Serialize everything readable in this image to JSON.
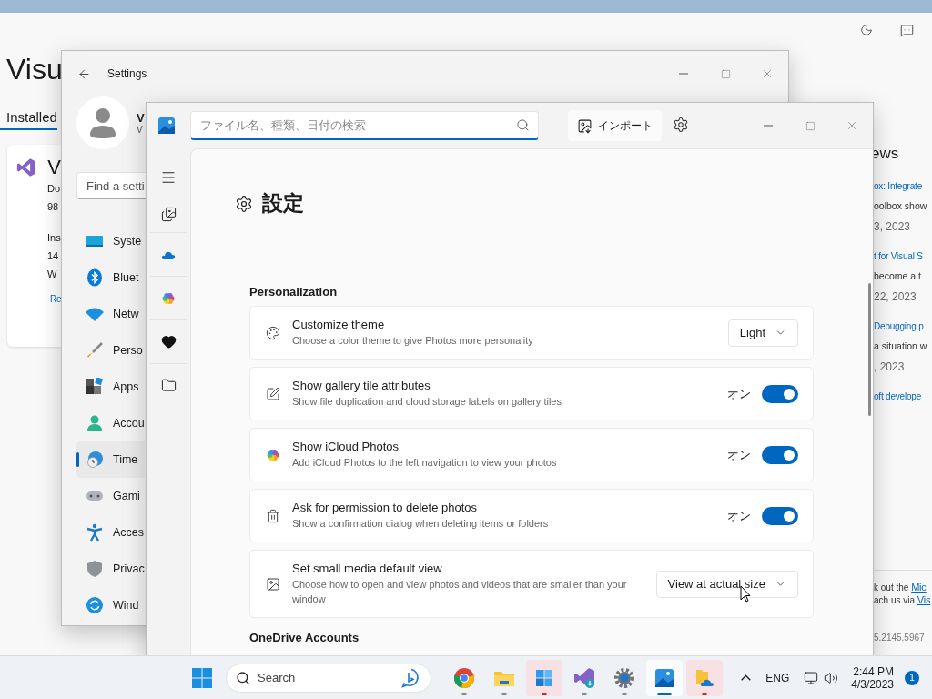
{
  "installer": {
    "title": "Visu",
    "tab": "Installed",
    "product": {
      "name": "V",
      "lines": [
        "Do",
        "98",
        "Ins",
        "14",
        "W"
      ],
      "link": "Re"
    },
    "news": {
      "title": "ews",
      "items": [
        {
          "link": "ox: Integrate",
          "text": "oolbox show",
          "date": "3, 2023"
        },
        {
          "link": "t for Visual S",
          "text": "become a t",
          "date": "22, 2023"
        },
        {
          "link": "Debugging p",
          "text": "a situation w",
          "date": ", 2023"
        },
        {
          "link": "oft develope"
        }
      ]
    },
    "footer": [
      {
        "text": "k out the ",
        "link": "Mic"
      },
      {
        "text": "ach us via ",
        "link": "Vis"
      }
    ],
    "version": "5.2145.5967"
  },
  "settings_window": {
    "title": "Settings",
    "user": {
      "name": "V",
      "email": "V"
    },
    "search": {
      "placeholder": "Find a setti"
    },
    "nav": [
      {
        "label": "Syste",
        "kind": "system",
        "selected": false
      },
      {
        "label": "Bluet",
        "kind": "bluetooth",
        "selected": false
      },
      {
        "label": "Netw",
        "kind": "network",
        "selected": false
      },
      {
        "label": "Perso",
        "kind": "personalization",
        "selected": false
      },
      {
        "label": "Apps",
        "kind": "apps",
        "selected": false
      },
      {
        "label": "Accou",
        "kind": "accounts",
        "selected": false
      },
      {
        "label": "Time",
        "kind": "time",
        "selected": true
      },
      {
        "label": "Gami",
        "kind": "gaming",
        "selected": false
      },
      {
        "label": "Acces",
        "kind": "accessibility",
        "selected": false
      },
      {
        "label": "Privac",
        "kind": "privacy",
        "selected": false
      },
      {
        "label": "Wind",
        "kind": "update",
        "selected": false
      }
    ]
  },
  "photos": {
    "search": {
      "placeholder": "ファイル名、種類、日付の検索"
    },
    "import": "インポート",
    "nav": [
      {
        "kind": "menu"
      },
      {
        "kind": "gallery"
      },
      {
        "kind": "onedrive"
      },
      {
        "kind": "icloud"
      },
      {
        "kind": "favorites"
      },
      {
        "kind": "folders"
      }
    ],
    "heading": "設定",
    "sections": [
      {
        "title": "Personalization",
        "items": [
          {
            "kind": "dropdown",
            "title": "Customize theme",
            "description": "Choose a color theme to give Photos more personality",
            "value": "Light"
          },
          {
            "kind": "toggle",
            "title": "Show gallery tile attributes",
            "description": "Show file duplication and cloud storage labels on gallery tiles",
            "state_label": "オン",
            "on": true
          },
          {
            "kind": "toggle",
            "title": "Show iCloud Photos",
            "description": "Add iCloud Photos to the left navigation to view your photos",
            "state_label": "オン",
            "on": true
          },
          {
            "kind": "toggle",
            "title": "Ask for permission to delete photos",
            "description": "Show a confirmation dialog when deleting items or folders",
            "state_label": "オン",
            "on": true
          },
          {
            "kind": "dropdown",
            "title": "Set small media default view",
            "description": "Choose how to open and view photos and videos that are smaller than your window",
            "value": "View at actual size"
          }
        ]
      },
      {
        "title": "OneDrive Accounts"
      }
    ]
  },
  "taskbar": {
    "search": "Search",
    "apps": [
      {
        "kind": "chrome",
        "active": false,
        "flashing": false,
        "color": "#8a8a8a"
      },
      {
        "kind": "explorer",
        "active": false,
        "flashing": false,
        "color": "#8a8a8a"
      },
      {
        "kind": "tiles",
        "active": false,
        "flashing": true,
        "color": "#c42b1c"
      },
      {
        "kind": "vs",
        "active": false,
        "flashing": false,
        "color": "#8a8a8a"
      },
      {
        "kind": "settings",
        "active": false,
        "flashing": false,
        "color": "#8a8a8a"
      },
      {
        "kind": "photos",
        "active": true,
        "flashing": false,
        "color": "#0067c0"
      },
      {
        "kind": "onedrive",
        "active": false,
        "flashing": true,
        "color": "#c42b1c"
      }
    ],
    "language": "ENG",
    "time": "2:44 PM",
    "date": "4/3/2023",
    "notifications": "1"
  }
}
